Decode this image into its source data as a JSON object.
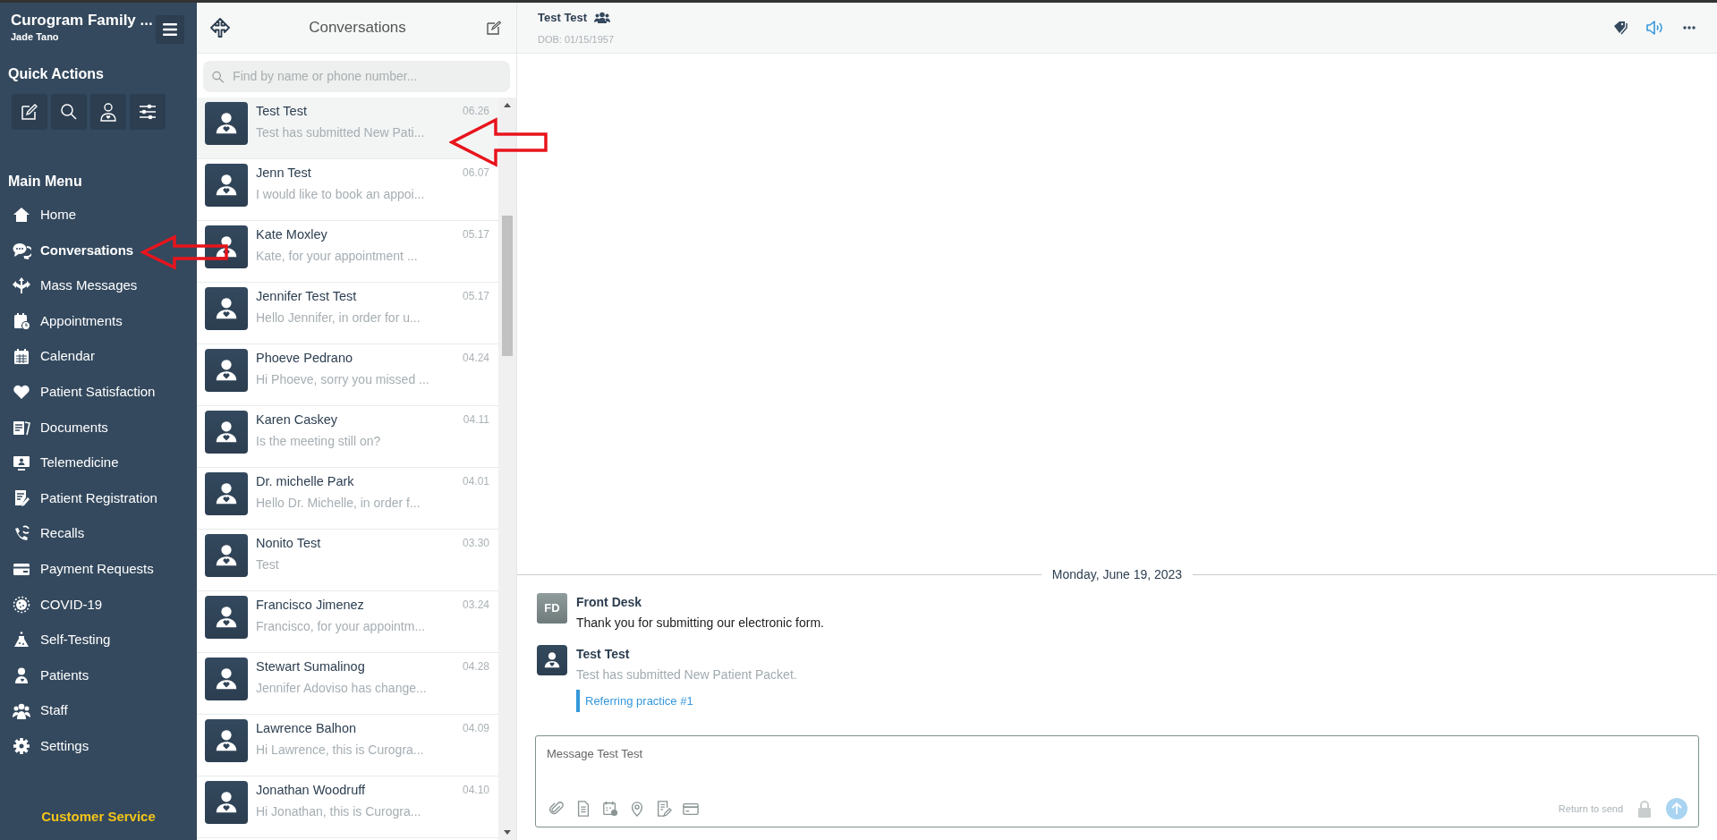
{
  "sidebar": {
    "org_name": "Curogram Family ...",
    "user_name": "Jade Tano",
    "quick_actions_title": "Quick Actions",
    "quick_actions": [
      {
        "kind": "compose"
      },
      {
        "kind": "search"
      },
      {
        "kind": "patient"
      },
      {
        "kind": "filters"
      }
    ],
    "main_menu_title": "Main Menu",
    "menu": [
      {
        "label": "Home",
        "kind": "home",
        "selected": false
      },
      {
        "label": "Conversations",
        "kind": "chat",
        "selected": true
      },
      {
        "label": "Mass Messages",
        "kind": "arrows",
        "selected": false
      },
      {
        "label": "Appointments",
        "kind": "appointments",
        "selected": false
      },
      {
        "label": "Calendar",
        "kind": "calendar",
        "selected": false
      },
      {
        "label": "Patient Satisfaction",
        "kind": "heart",
        "selected": false
      },
      {
        "label": "Documents",
        "kind": "documents",
        "selected": false
      },
      {
        "label": "Telemedicine",
        "kind": "monitor",
        "selected": false
      },
      {
        "label": "Patient Registration",
        "kind": "registration",
        "selected": false
      },
      {
        "label": "Recalls",
        "kind": "phone",
        "selected": false
      },
      {
        "label": "Payment Requests",
        "kind": "card",
        "selected": false
      },
      {
        "label": "COVID-19",
        "kind": "virus",
        "selected": false
      },
      {
        "label": "Self-Testing",
        "kind": "flask",
        "selected": false
      },
      {
        "label": "Patients",
        "kind": "person",
        "selected": false
      },
      {
        "label": "Staff",
        "kind": "group",
        "selected": false
      },
      {
        "label": "Settings",
        "kind": "gear",
        "selected": false
      }
    ],
    "footer_link": "Customer Service"
  },
  "conversations": {
    "title": "Conversations",
    "search": {
      "placeholder": "Find by name or phone number..."
    },
    "items": [
      {
        "name": "Test Test",
        "preview": "Test has submitted New Pati...",
        "time": "06.26",
        "selected": true
      },
      {
        "name": "Jenn Test",
        "preview": "I would like to book an appoi...",
        "time": "06.07",
        "selected": false
      },
      {
        "name": "Kate Moxley",
        "preview": "Kate, for your appointment ...",
        "time": "05.17",
        "selected": false
      },
      {
        "name": "Jennifer Test Test",
        "preview": "Hello Jennifer, in order for u...",
        "time": "05.17",
        "selected": false
      },
      {
        "name": "Phoeve Pedrano",
        "preview": "Hi Phoeve, sorry you missed ...",
        "time": "04.24",
        "selected": false
      },
      {
        "name": "Karen Caskey",
        "preview": "Is the meeting still on?",
        "time": "04.11",
        "selected": false
      },
      {
        "name": "Dr. michelle Park",
        "preview": "Hello Dr. Michelle, in order f...",
        "time": "04.01",
        "selected": false
      },
      {
        "name": "Nonito Test",
        "preview": "Test",
        "time": "03.30",
        "selected": false
      },
      {
        "name": "Francisco Jimenez",
        "preview": "Francisco, for your appointm...",
        "time": "03.24",
        "selected": false
      },
      {
        "name": "Stewart Sumalinog",
        "preview": "Jennifer Adoviso has change...",
        "time": "04.28",
        "selected": false
      },
      {
        "name": "Lawrence Balhon",
        "preview": "Hi Lawrence, this is Curogra...",
        "time": "04.09",
        "selected": false
      },
      {
        "name": "Jonathan Woodruff",
        "preview": "Hi Jonathan, this is Curogra...",
        "time": "04.10",
        "selected": false
      }
    ]
  },
  "chat": {
    "patient_name": "Test Test",
    "dob": "DOB: 01/15/1957",
    "date_divider": "Monday, June 19, 2023",
    "messages": [
      {
        "kind": "staff",
        "initials": "FD",
        "sender": "Front Desk",
        "text": "Thank you for submitting our electronic form."
      },
      {
        "kind": "patient",
        "sender": "Test Test",
        "text": "Test has submitted New Patient Packet.",
        "link": "Referring practice #1"
      }
    ],
    "composer": {
      "placeholder": "Message Test Test",
      "hint": "Return to send"
    }
  }
}
